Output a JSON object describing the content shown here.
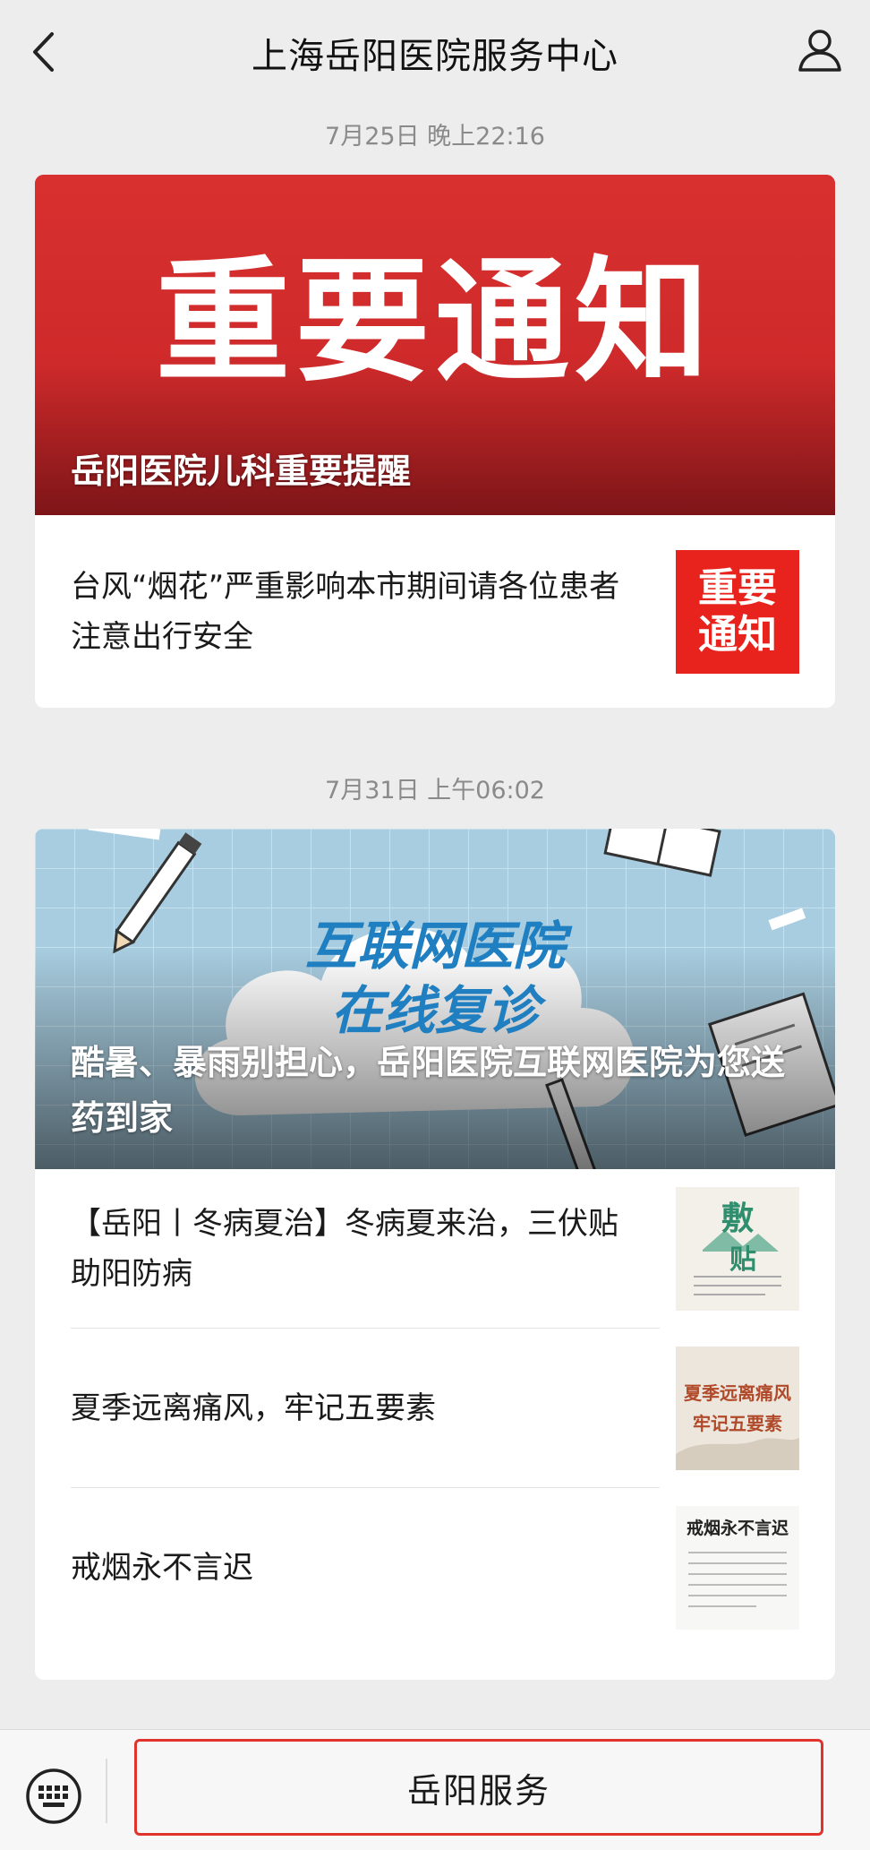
{
  "header": {
    "title": "上海岳阳医院服务中心",
    "back_icon": "chevron-left-icon",
    "profile_icon": "person-icon"
  },
  "messages": [
    {
      "time": "7月25日 晚上22:16",
      "cover": {
        "banner_text": "重要通知",
        "caption": "岳阳医院儿科重要提醒",
        "bg_color": "#d6292b"
      },
      "items": [
        {
          "text": "台风“烟花”严重影响本市期间请各位患者注意出行安全",
          "thumb_text": [
            "重要",
            "通知"
          ]
        }
      ]
    },
    {
      "time": "7月31日 上午06:02",
      "cover": {
        "banner_line1": "互联网医院",
        "banner_line2": "在线复诊",
        "caption": "酷暑、暴雨别担心，岳阳医院互联网医院为您送药到家",
        "bg_color": "#a9cfe1"
      },
      "items": [
        {
          "text": "【岳阳丨冬病夏治】冬病夏来治，三伏贴助阳防病",
          "thumb_text": [
            "敷",
            "贴"
          ]
        },
        {
          "text": "夏季远离痛风，牢记五要素",
          "thumb_text": [
            "夏季远离痛风",
            "牢记五要素"
          ]
        },
        {
          "text": "戒烟永不言迟",
          "thumb_text": [
            "戒烟永不言迟"
          ]
        }
      ]
    }
  ],
  "bottom": {
    "keyboard_icon": "keyboard-icon",
    "service_label": "岳阳服务"
  }
}
